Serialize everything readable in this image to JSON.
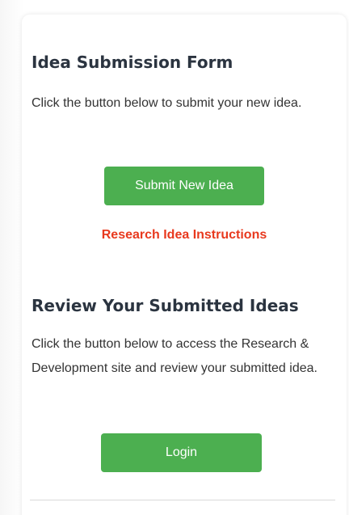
{
  "submission": {
    "title": "Idea Submission Form",
    "description": "Click the button below to submit your new idea.",
    "button_label": "Submit New Idea",
    "instructions_link": "Research Idea Instructions"
  },
  "review": {
    "title": "Review Your Submitted Ideas",
    "description": "Click the button below to access the Research & Development site and review your submitted idea.",
    "button_label": "Login"
  },
  "colors": {
    "button": "#4caf50",
    "link": "#e8391e",
    "heading": "#2b3440"
  }
}
